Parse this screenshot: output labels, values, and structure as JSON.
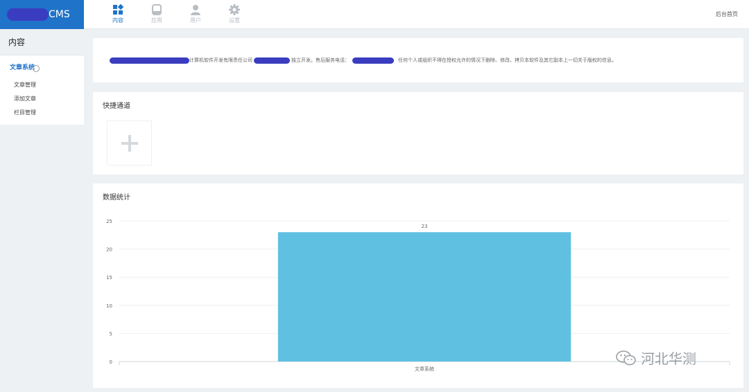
{
  "brand": {
    "text": "CMS"
  },
  "nav": {
    "items": [
      {
        "label": "内容",
        "icon": "grid-icon",
        "active": true
      },
      {
        "label": "应用",
        "icon": "app-icon",
        "active": false
      },
      {
        "label": "用户",
        "icon": "user-icon",
        "active": false
      },
      {
        "label": "设置",
        "icon": "gear-icon",
        "active": false
      }
    ],
    "right_link": "后台首页"
  },
  "sidebar": {
    "title": "内容",
    "group": "文章系统",
    "items": [
      "文章管理",
      "添加文章",
      "栏目管理"
    ]
  },
  "notice": {
    "segments": [
      "计算机软件开发有限责任公司",
      "独立开发。售后服务电话：",
      "任何个人或组织不得在授权允许的情况下删除、修改、拷贝本软件及其它副本上一切关于版权的信息。"
    ]
  },
  "quick": {
    "title": "快捷通道"
  },
  "stats": {
    "title": "数据统计"
  },
  "chart_data": {
    "type": "bar",
    "categories": [
      "文章系统"
    ],
    "values": [
      23
    ],
    "ylim": [
      0,
      25
    ],
    "yticks": [
      0,
      5,
      10,
      15,
      20,
      25
    ],
    "grid": true,
    "bar_color": "#60c0e2"
  },
  "watermark": {
    "text": "河北华测"
  },
  "colors": {
    "accent": "#1f73c9"
  }
}
